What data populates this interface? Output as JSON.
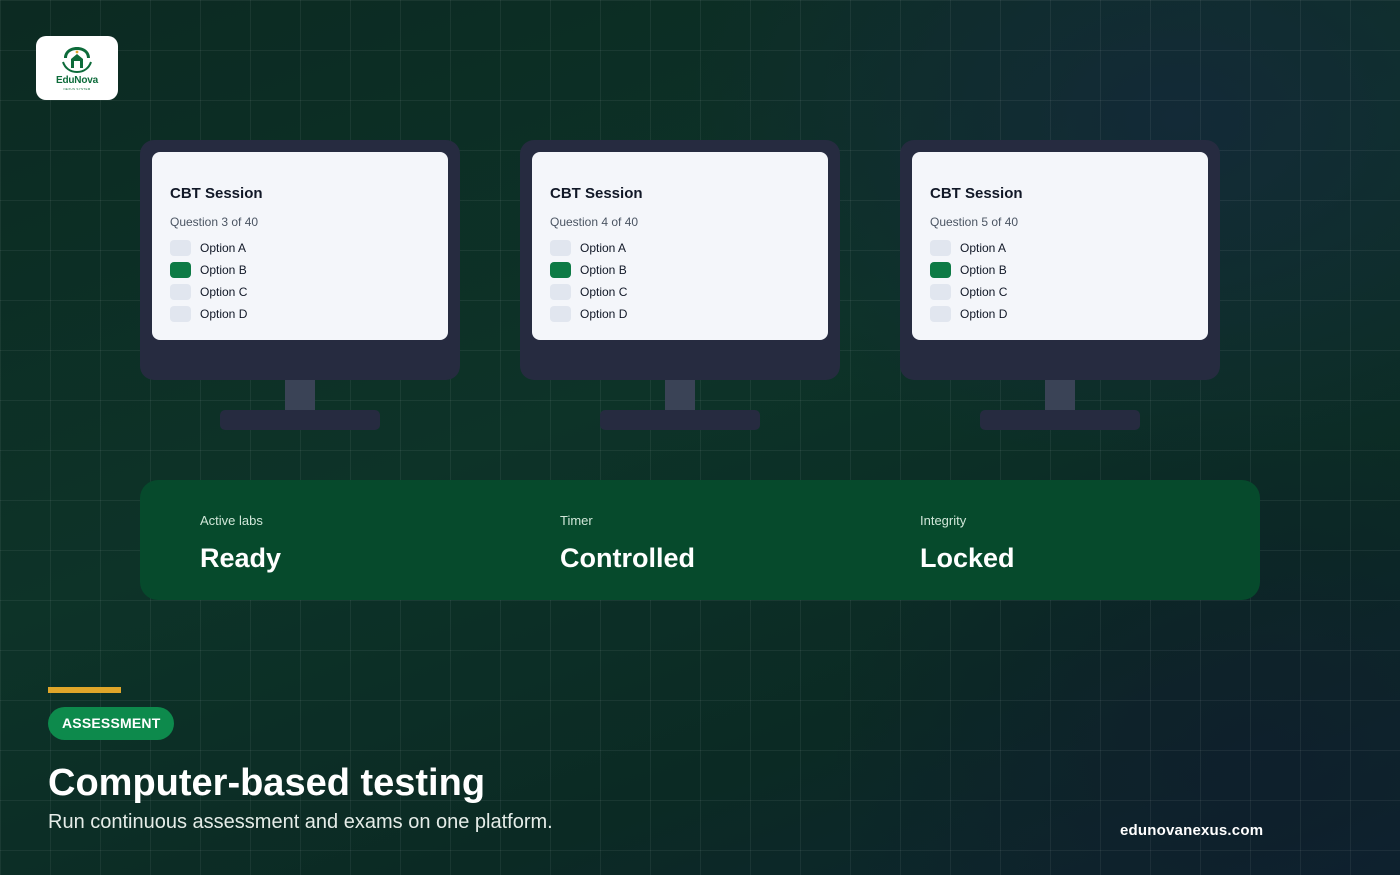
{
  "brand": {
    "name": "EduNova",
    "tagline": "NEXUS SYSTEM",
    "website": "edunovanexus.com"
  },
  "colors": {
    "accent_green": "#0d8a4c",
    "selected_option": "#0d7a45",
    "stats_panel": "#064a2c",
    "accent_bar": "#e0a62a",
    "monitor_frame": "#262b40"
  },
  "monitors": [
    {
      "title": "CBT Session",
      "question": "Question 3 of 40",
      "options": [
        {
          "label": "Option A",
          "selected": false
        },
        {
          "label": "Option B",
          "selected": true
        },
        {
          "label": "Option C",
          "selected": false
        },
        {
          "label": "Option D",
          "selected": false
        }
      ]
    },
    {
      "title": "CBT Session",
      "question": "Question 4 of 40",
      "options": [
        {
          "label": "Option A",
          "selected": false
        },
        {
          "label": "Option B",
          "selected": true
        },
        {
          "label": "Option C",
          "selected": false
        },
        {
          "label": "Option D",
          "selected": false
        }
      ]
    },
    {
      "title": "CBT Session",
      "question": "Question 5 of 40",
      "options": [
        {
          "label": "Option A",
          "selected": false
        },
        {
          "label": "Option B",
          "selected": true
        },
        {
          "label": "Option C",
          "selected": false
        },
        {
          "label": "Option D",
          "selected": false
        }
      ]
    }
  ],
  "stats": [
    {
      "label": "Active labs",
      "value": "Ready"
    },
    {
      "label": "Timer",
      "value": "Controlled"
    },
    {
      "label": "Integrity",
      "value": "Locked"
    }
  ],
  "hero": {
    "badge": "ASSESSMENT",
    "headline": "Computer-based testing",
    "subline": "Run continuous assessment and exams on one platform."
  }
}
